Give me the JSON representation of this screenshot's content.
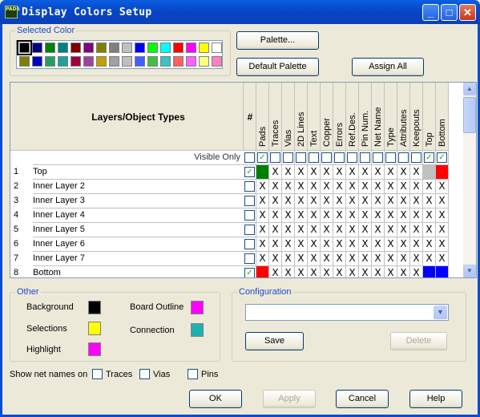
{
  "window": {
    "title": "Display Colors Setup",
    "app_icon_text": "PADS",
    "minimize": "_",
    "maximize": "□",
    "close": "✕"
  },
  "selected_color": {
    "legend": "Selected Color",
    "row1": [
      "#000000",
      "#000080",
      "#008000",
      "#008080",
      "#800000",
      "#800080",
      "#808000",
      "#808080",
      "#c0c0c0",
      "#0000ff",
      "#00ff00",
      "#00ffff",
      "#ff0000",
      "#ff00ff",
      "#ffff00",
      "#ffffff"
    ],
    "row2": [
      "#808000",
      "#0000c0",
      "#20a060",
      "#20a0a0",
      "#a00040",
      "#a040a0",
      "#c0a000",
      "#a0a0a0",
      "#c0c0c0",
      "#4060ff",
      "#40c040",
      "#40c0c0",
      "#ff6060",
      "#ff60ff",
      "#ffff80",
      "#ff80c0"
    ]
  },
  "buttons": {
    "palette": "Palette...",
    "default_palette": "Default Palette",
    "assign_all": "Assign All",
    "save": "Save",
    "delete": "Delete",
    "ok": "OK",
    "apply": "Apply",
    "cancel": "Cancel",
    "help": "Help"
  },
  "grid": {
    "header_title": "Layers/Object Types",
    "hash": "#",
    "columns": [
      "Pads",
      "Traces",
      "Vias",
      "2D Lines",
      "Text",
      "Copper",
      "Errors",
      "Ref.Des.",
      "Pin Num.",
      "Net Name",
      "Type",
      "Attributes",
      "Keepouts",
      "Top",
      "Bottom"
    ],
    "visible_only_label": "Visible Only",
    "rows": [
      {
        "num": "1",
        "name": "Top"
      },
      {
        "num": "2",
        "name": "Inner Layer 2"
      },
      {
        "num": "3",
        "name": "Inner Layer 3"
      },
      {
        "num": "4",
        "name": "Inner Layer 4"
      },
      {
        "num": "5",
        "name": "Inner Layer 5"
      },
      {
        "num": "6",
        "name": "Inner Layer 6"
      },
      {
        "num": "7",
        "name": "Inner Layer 7"
      },
      {
        "num": "8",
        "name": "Bottom"
      }
    ],
    "x_mark": "X"
  },
  "other": {
    "legend": "Other",
    "background": "Background",
    "selections": "Selections",
    "highlight": "Highlight",
    "board_outline": "Board Outline",
    "connection": "Connection",
    "colors": {
      "background": "#000000",
      "selections": "#ffff00",
      "highlight": "#ff00ff",
      "board_outline": "#ff00ff",
      "connection": "#20b0b0"
    }
  },
  "configuration": {
    "legend": "Configuration",
    "value": ""
  },
  "net_names": {
    "label": "Show net names on",
    "traces": "Traces",
    "vias": "Vias",
    "pins": "Pins"
  }
}
